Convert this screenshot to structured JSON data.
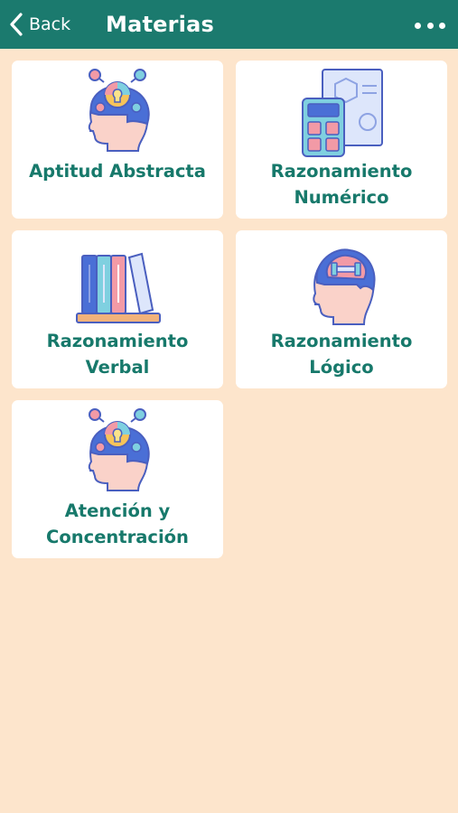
{
  "header": {
    "back_label": "Back",
    "title": "Materias",
    "back_icon": "chevron-left-icon",
    "more_icon": "more-horizontal-icon"
  },
  "subjects": [
    {
      "line1": "Aptitud Abstracta",
      "line2": "",
      "icon": "head-lightbulb-icon"
    },
    {
      "line1": "Razonamiento",
      "line2": "Numérico",
      "icon": "calculator-icon"
    },
    {
      "line1": "Razonamiento",
      "line2": "Verbal",
      "icon": "books-icon"
    },
    {
      "line1": "Razonamiento",
      "line2": "Lógico",
      "icon": "brain-dumbbell-icon"
    },
    {
      "line1": "Atención y",
      "line2": "Concentración",
      "icon": "head-lightbulb-icon"
    }
  ],
  "colors": {
    "header": "#1B7A6E",
    "background": "#FDE5CC",
    "label": "#17796B"
  }
}
